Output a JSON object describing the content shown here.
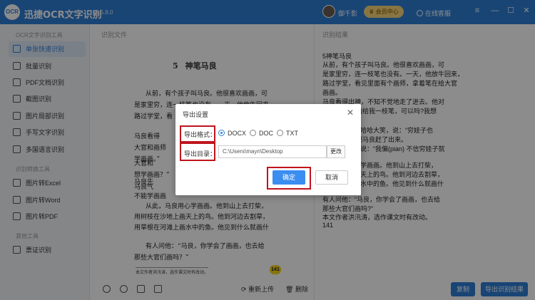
{
  "app": {
    "logo_text": "OCR",
    "title": "迅捷OCR文字识别",
    "version": "v8.5.8.0",
    "user_name": "御千影",
    "vip_label": "会员中心",
    "support_label": "在线客服"
  },
  "sidebar": {
    "section1": "OCR文字识别工具",
    "items1": [
      "单张快速识别",
      "批量识别",
      "PDF文档识别",
      "截图识别",
      "图片局部识别",
      "手写文字识别",
      "多国语言识别"
    ],
    "section2": "识别转换工具",
    "items2": [
      "图片转Excel",
      "图片转Word",
      "图片转PDF"
    ],
    "section3": "其他工具",
    "items3": [
      "票证识别"
    ]
  },
  "panels": {
    "left_label": "识别文件",
    "right_label": "识别结果"
  },
  "document": {
    "chapter_no": "5",
    "heading": "神笔马良",
    "lines": [
      "从前，有个孩子叫马良。他很喜欢画画，可",
      "是家里穷，连一枝笔也没有。一天，他放牛回来，",
      "路过学堂，看",
      "",
      "马良看得",
      "大官和画师",
      "学画画。”",
      "",
      "马良先",
      "",
      "大官和",
      "想学画画？”",
      "",
      "马良气",
      "不能学画画",
      "从此，马良用心学画画。他到山上去打柴，",
      "用树枝在沙地上画天上的鸟。他到河边去割草，",
      "用草根在河滩上画水中的鱼。他见到什么就画什",
      "",
      "有人问他：“马良，你学会了画画，也去给",
      "那些大官们画吗？”"
    ],
    "footnote": "本文作者洪汛涛，选作课文时有改动。",
    "page_no": "141"
  },
  "bottom_toolbar": {
    "reupload_label": "重新上传",
    "delete_label": "删除",
    "copy_label": "复制",
    "export_label": "导出识别结果"
  },
  "result": {
    "lines": [
      "5神笔马良",
      "从前，有个孩子叫马良。他很喜欢画画，可",
      "是家里穷，连一枝笔也没有。一天，他放牛回来，",
      "路过学堂，看见里面有个画师，拿着笔在给大官",
      "画画。",
      "马良看得出神，不知不觉地走了进去。他对",
      "“请给我一枝笔，可以吗?我想",
      "",
      "吟哈哈大笑，说：“穷娃子也",
      "”把马良赶了出来。",
      "地说：“我偏(pian) 不信穷娃子就",
      "",
      "心学画画。他到山上去打柴，",
      "画天上的鸟。他到河边去割草，",
      "画水中的鱼。他见到什么就画什",
      "",
      "有人问他：“马良，你学会了画画，也去给",
      "那些大官们画吗?”",
      "本文作者洪汛涛，选作课文时有改动。",
      "141"
    ]
  },
  "dialog": {
    "title": "导出设置",
    "format_label": "导出格式：",
    "formats": [
      "DOCX",
      "DOC",
      "TXT"
    ],
    "selected_format": "DOCX",
    "dir_label": "导出目录：",
    "dir_value": "C:\\Users\\mayn\\Desktop",
    "change_label": "更改",
    "ok_label": "确定",
    "cancel_label": "取消"
  }
}
